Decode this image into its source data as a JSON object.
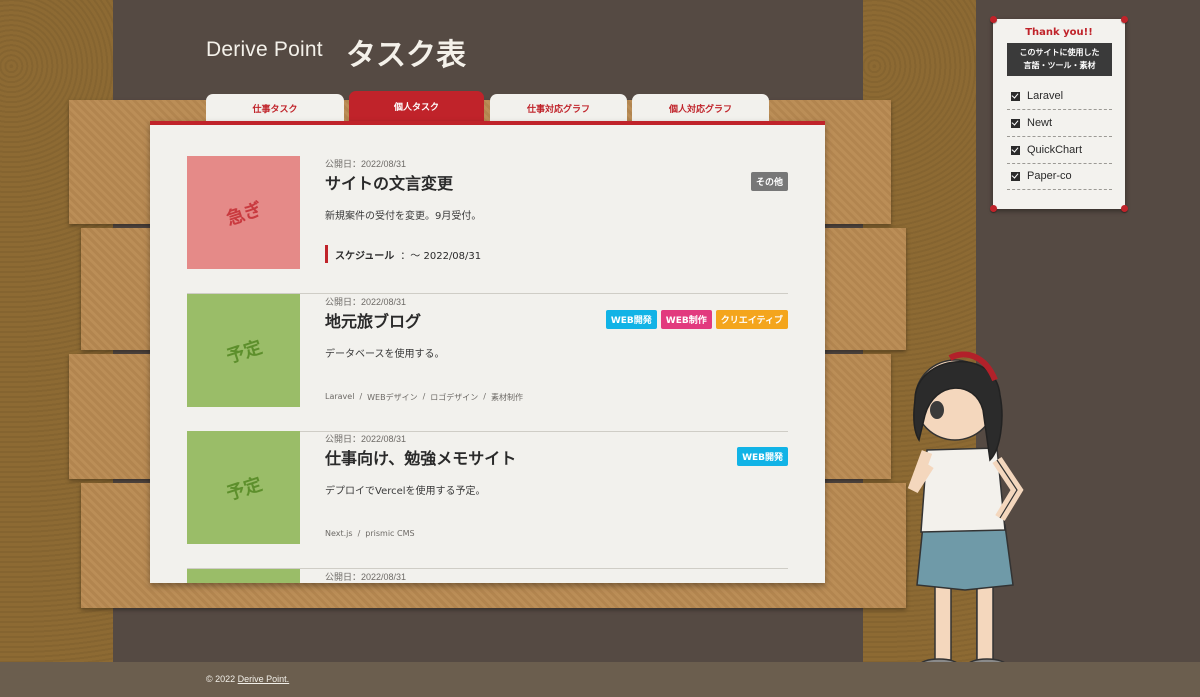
{
  "header": {
    "brand": "Derive Point",
    "title": "タスク表"
  },
  "tabs": [
    {
      "label": "仕事タスク",
      "active": false
    },
    {
      "label": "個人タスク",
      "active": true
    },
    {
      "label": "仕事対応グラフ",
      "active": false
    },
    {
      "label": "個人対応グラフ",
      "active": false
    }
  ],
  "cards": [
    {
      "thumb": "急ぎ",
      "date": "公開日：2022/08/31",
      "title": "サイトの文言変更",
      "desc": "新規案件の受付を変更。9月受付。",
      "tags": [
        {
          "label": "その他",
          "color": "#777777"
        }
      ],
      "schedule_label": "スケジュール",
      "schedule_value": "：～ 2022/08/31"
    },
    {
      "thumb": "予定",
      "date": "公開日：2022/08/31",
      "title": "地元旅ブログ",
      "desc": "データベースを使用する。",
      "tags": [
        {
          "label": "WEB開発",
          "color": "#11b3e6"
        },
        {
          "label": "WEB制作",
          "color": "#e23a7e"
        },
        {
          "label": "クリエイティブ",
          "color": "#f4a51c"
        }
      ],
      "techs": [
        "Laravel",
        "WEBデザイン",
        "ロゴデザイン",
        "素材制作"
      ]
    },
    {
      "thumb": "予定",
      "date": "公開日：2022/08/31",
      "title": "仕事向け、勉強メモサイト",
      "desc": "デプロイでVercelを使用する予定。",
      "tags": [
        {
          "label": "WEB開発",
          "color": "#11b3e6"
        }
      ],
      "techs": [
        "Next.js",
        "prismic CMS"
      ]
    },
    {
      "date": "公開日：2022/08/31"
    }
  ],
  "note": {
    "title": "Thank you!!",
    "box": [
      "このサイトに使用した",
      "言語・ツール・素材"
    ],
    "items": [
      "Laravel",
      "Newt",
      "QuickChart",
      "Paper-co"
    ]
  },
  "footer": {
    "copy_prefix": "© 2022 ",
    "copy_link": "Derive Point."
  },
  "colors": {
    "accent": "#c0232a",
    "urgent_thumb": "#e58a88",
    "plan_thumb": "#9abd68"
  }
}
